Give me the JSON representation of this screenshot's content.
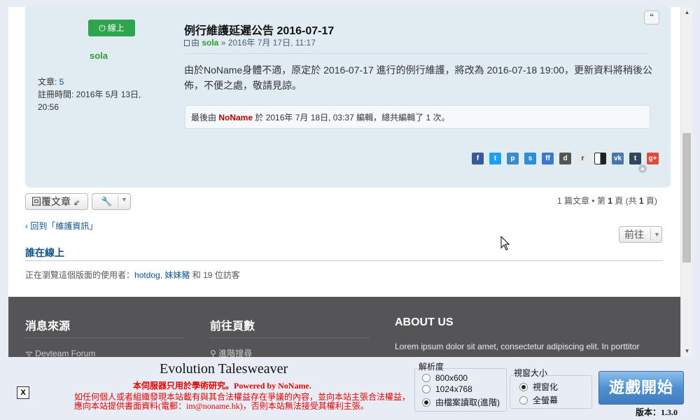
{
  "post": {
    "online_badge": "線上",
    "author": "sola",
    "profile": {
      "posts_label": "文章: ",
      "posts_count": "5",
      "joined": "註冊時間: 2016年 5月 13日, 20:56"
    },
    "title": "例行維護延遲公告 2016-07-17",
    "meta_by": "由 ",
    "meta_user": "sola",
    "meta_date": " » 2016年 7月 17日, 11:17",
    "body": "由於NoName身體不適，原定於 2016-07-17 進行的例行維護，將改為 2016-07-18 19:00，更新資料將稍後公佈，不便之處，敬請見諒。",
    "edit_prefix": "最後由 ",
    "edit_user": "NoName",
    "edit_suffix": " 於 2016年 7月 18日, 03:37 編輯，總共編輯了 1 次。",
    "quote_button": "“"
  },
  "share": [
    {
      "name": "facebook-icon",
      "glyph": "f",
      "color": "#3b5998"
    },
    {
      "name": "twitter-icon",
      "glyph": "t",
      "color": "#1da1f2"
    },
    {
      "name": "plurk-icon",
      "glyph": "p",
      "color": "#3e8bc8"
    },
    {
      "name": "share-icon",
      "glyph": "s",
      "color": "#2d8fd0"
    },
    {
      "name": "friendfeed-icon",
      "glyph": "ff",
      "color": "#3b78c9"
    },
    {
      "name": "digg-icon",
      "glyph": "d",
      "color": "#555555"
    },
    {
      "name": "reddit-icon",
      "glyph": "r",
      "color": "#e8e8e8"
    },
    {
      "name": "delicious-icon",
      "glyph": "",
      "color": "#222222"
    },
    {
      "name": "vk-icon",
      "glyph": "vk",
      "color": "#4a76a8"
    },
    {
      "name": "tumblr-icon",
      "glyph": "t",
      "color": "#35465c"
    },
    {
      "name": "googleplus-icon",
      "glyph": "g+",
      "color": "#dd4b39"
    }
  ],
  "actions": {
    "reply": "回覆文章",
    "pagination_prefix": "1 篇文章 • 第 ",
    "pagination_page": "1",
    "pagination_mid": " 頁 (共 ",
    "pagination_total": "1",
    "pagination_suffix": " 頁)",
    "back_link": "回到「維護資訊」",
    "prev": "前往"
  },
  "whos_online": {
    "title": "誰在線上",
    "prefix": "正在瀏覽這個版面的使用者：",
    "user1": "hotdog",
    "sep": ", ",
    "user2": "妹妹豬",
    "suffix": " 和 19 位訪客"
  },
  "footer": {
    "col1_title": "消息來源",
    "col1_link": "Devteam Forum",
    "col2_title": "前往頁數",
    "col2_link": "進階搜尋",
    "col3_title": "ABOUT US",
    "about": "Lorem ipsum dolor sit amet, consectetur adipiscing elit. In porttitor"
  },
  "launcher": {
    "close": "X",
    "game_title": "Evolution Talesweaver",
    "notice_1": "本伺服器只用於學術研究。Powered by NoName.",
    "notice_2": "如任何個人或者組織發現本站載有與其合法權益存在爭議的內容，並向本站主張合法權益，應向本站提供書面資料(電郵：im@noname.hk)，否則本站無法接受其權利主張。",
    "resolution_label": "解析度",
    "res_options": [
      "800x600",
      "1024x768",
      "由檔案讀取(進階)"
    ],
    "res_selected": 2,
    "window_label": "視窗大小",
    "window_options": [
      "視窗化",
      "全螢幕"
    ],
    "window_selected": 0,
    "start": "遊戲開始",
    "version": "版本：1.3.0"
  }
}
